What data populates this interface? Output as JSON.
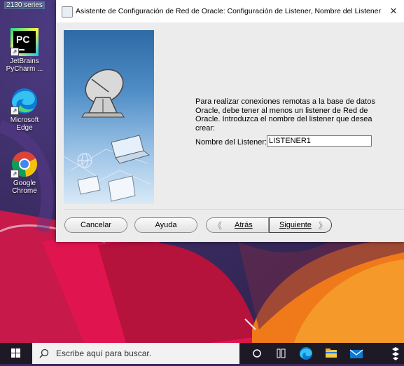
{
  "desktop": {
    "icons": [
      {
        "label_top": "2130 series"
      },
      {
        "label": "JetBrains PyCharm ..."
      },
      {
        "label": "Microsoft Edge"
      },
      {
        "label": "Google Chrome"
      }
    ]
  },
  "dialog": {
    "title": "Asistente de Configuración de Red de Oracle: Configuración de Listener, Nombre del Listener",
    "close_glyph": "✕",
    "prompt": "Para realizar conexiones remotas a la base de datos Oracle, debe tener al menos un listener de Red de Oracle. Introduzca el nombre del listener que desea crear:",
    "listener_label": "Nombre del Listener:",
    "listener_value": "LISTENER1",
    "buttons": {
      "cancel": "Cancelar",
      "help": "Ayuda",
      "back": "Atrás",
      "next": "Siguiente"
    }
  },
  "taskbar": {
    "search_placeholder": "Escribe aquí para buscar.",
    "icons": [
      "windows-start-icon",
      "search-icon",
      "cortana-icon",
      "task-view-icon",
      "edge-icon",
      "file-explorer-icon",
      "mail-icon",
      "dropbox-icon"
    ]
  },
  "colors": {
    "dialog_bg": "#ececec",
    "taskbar_bg": "#1d1a26",
    "accent_blue": "#0078d7"
  }
}
